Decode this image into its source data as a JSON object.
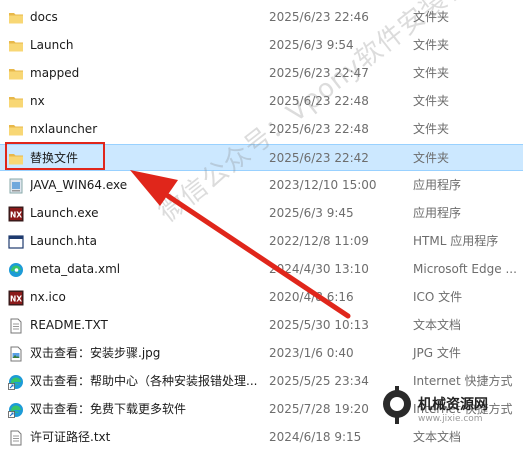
{
  "files": [
    {
      "name": "docs",
      "date": "2025/6/23 22:46",
      "type": "文件夹",
      "icon": "folder-icon"
    },
    {
      "name": "Launch",
      "date": "2025/6/3 9:54",
      "type": "文件夹",
      "icon": "folder-icon"
    },
    {
      "name": "mapped",
      "date": "2025/6/23 22:47",
      "type": "文件夹",
      "icon": "folder-icon"
    },
    {
      "name": "nx",
      "date": "2025/6/23 22:48",
      "type": "文件夹",
      "icon": "folder-icon"
    },
    {
      "name": "nxlauncher",
      "date": "2025/6/23 22:48",
      "type": "文件夹",
      "icon": "folder-icon"
    },
    {
      "name": "替换文件",
      "date": "2025/6/23 22:42",
      "type": "文件夹",
      "icon": "folder-icon",
      "selected": true
    },
    {
      "name": "JAVA_WIN64.exe",
      "date": "2023/12/10 15:00",
      "type": "应用程序",
      "icon": "installer-exe-icon"
    },
    {
      "name": "Launch.exe",
      "date": "2025/6/3 9:45",
      "type": "应用程序",
      "icon": "nx-app-icon"
    },
    {
      "name": "Launch.hta",
      "date": "2022/12/8 11:09",
      "type": "HTML 应用程序",
      "icon": "hta-window-icon"
    },
    {
      "name": "meta_data.xml",
      "date": "2024/4/30 13:10",
      "type": "Microsoft Edge ...",
      "icon": "edge-icon"
    },
    {
      "name": "nx.ico",
      "date": "2020/4/8 6:16",
      "type": "ICO 文件",
      "icon": "nx-app-icon"
    },
    {
      "name": "README.TXT",
      "date": "2025/5/30 10:13",
      "type": "文本文档",
      "icon": "text-document-icon"
    },
    {
      "name": "双击查看：安装步骤.jpg",
      "date": "2023/1/6 0:40",
      "type": "JPG 文件",
      "icon": "image-file-icon"
    },
    {
      "name": "双击查看：帮助中心（各种安装报错处理...",
      "date": "2025/5/25 23:34",
      "type": "Internet 快捷方式",
      "icon": "edge-shortcut-icon"
    },
    {
      "name": "双击查看：免费下载更多软件",
      "date": "2025/7/28 19:20",
      "type": "Internet 快捷方式",
      "icon": "edge-shortcut-icon"
    },
    {
      "name": "许可证路径.txt",
      "date": "2024/6/18 9:15",
      "type": "文本文档",
      "icon": "text-document-icon"
    }
  ],
  "watermark": "微信公众号：Vpony软件安装管家",
  "logo": {
    "title": "机械资源网",
    "subtitle": "www.jixie.com"
  },
  "colors": {
    "selection": "#cce8ff",
    "highlight_box": "#e0261b",
    "arrow": "#e0261b",
    "folder": "#f8d775"
  }
}
